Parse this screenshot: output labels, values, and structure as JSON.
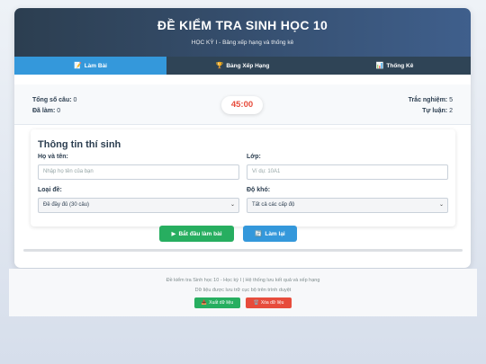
{
  "header": {
    "title": "ĐỀ KIỂM TRA SINH HỌC 10",
    "subtitle": "HỌC KỲ I - Bảng xếp hạng và thống kê"
  },
  "tabs": [
    {
      "icon": "📝",
      "label": "Làm Bài"
    },
    {
      "icon": "🏆",
      "label": "Bảng Xếp Hạng"
    },
    {
      "icon": "📊",
      "label": "Thống Kê"
    }
  ],
  "stats": {
    "total_label": "Tổng số câu:",
    "total_value": "0",
    "done_label": "Đã làm:",
    "done_value": "0",
    "timer": "45:00",
    "mc_label": "Trắc nghiệm:",
    "mc_value": "5",
    "essay_label": "Tự luận:",
    "essay_value": "2"
  },
  "form": {
    "title": "Thông tin thí sinh",
    "name_label": "Họ và tên:",
    "name_placeholder": "Nhập họ tên của bạn",
    "class_label": "Lớp:",
    "class_placeholder": "Ví dụ: 10A1",
    "type_label": "Loại đề:",
    "type_value": "Đề đầy đủ (30 câu)",
    "difficulty_label": "Độ khó:",
    "difficulty_value": "Tất cả các cấp độ"
  },
  "actions": {
    "start_icon": "▶",
    "start_label": "Bắt đầu làm bài",
    "reset_icon": "🔄",
    "reset_label": "Làm lại"
  },
  "footer": {
    "line1": "Đề kiểm tra Sinh học 10 - Học kỳ I | Hệ thống lưu kết quả và xếp hạng",
    "line2": "Dữ liệu được lưu trữ cục bộ trên trình duyệt",
    "export_icon": "📥",
    "export_label": "Xuất dữ liệu",
    "clear_icon": "🗑️",
    "clear_label": "Xóa dữ liệu"
  }
}
